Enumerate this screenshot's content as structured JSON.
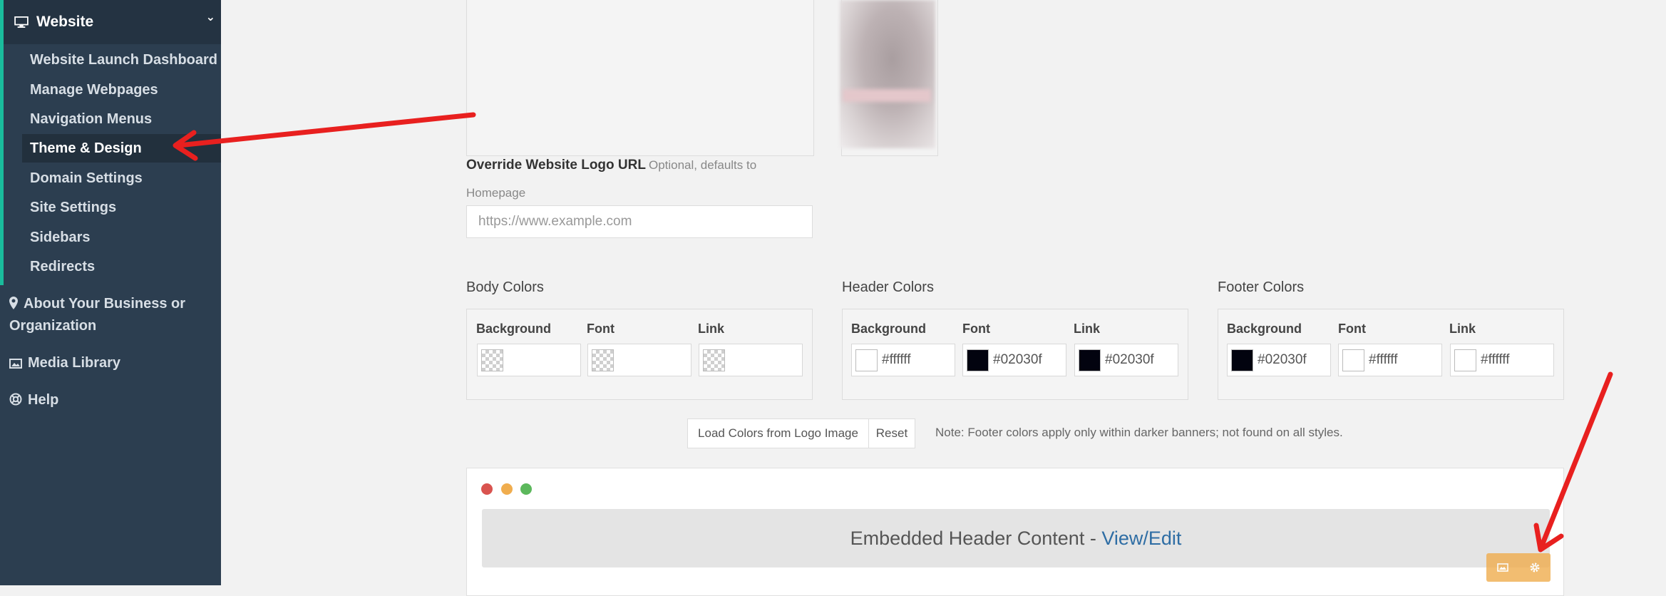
{
  "sidebar": {
    "header_label": "Website",
    "sub_items": [
      {
        "label": "Website Launch Dashboard"
      },
      {
        "label": "Manage Webpages"
      },
      {
        "label": "Navigation Menus"
      },
      {
        "label": "Theme & Design",
        "active": true
      },
      {
        "label": "Domain Settings"
      },
      {
        "label": "Site Settings"
      },
      {
        "label": "Sidebars"
      },
      {
        "label": "Redirects"
      }
    ],
    "about_line1": "About Your Business or",
    "about_line2": "Organization",
    "media_label": "Media Library",
    "help_label": "Help"
  },
  "logo": {
    "override_label": "Override Website Logo URL",
    "override_hint_1": "Optional, defaults to",
    "override_hint_2": "Homepage",
    "url_placeholder": "https://www.example.com",
    "url_value": ""
  },
  "colors": {
    "body": {
      "title": "Body Colors",
      "labels": [
        "Background",
        "Font",
        "Link"
      ],
      "values": [
        "",
        "",
        ""
      ]
    },
    "header": {
      "title": "Header Colors",
      "labels": [
        "Background",
        "Font",
        "Link"
      ],
      "values": [
        "#ffffff",
        "#02030f",
        "#02030f"
      ]
    },
    "footer": {
      "title": "Footer Colors",
      "labels": [
        "Background",
        "Font",
        "Link"
      ],
      "values": [
        "#02030f",
        "#ffffff",
        "#ffffff"
      ]
    }
  },
  "actions": {
    "load_colors_label": "Load Colors from Logo Image",
    "reset_label": "Reset",
    "note": "Note: Footer colors apply only within darker banners; not found on all styles."
  },
  "preview": {
    "embedded_text": "Embedded Header Content - ",
    "embedded_link": "View/Edit",
    "window_dots": [
      "#d9534f",
      "#f0ad4e",
      "#5cb85c"
    ]
  },
  "theme": {
    "sidebar_bg": "#2c3e50",
    "sidebar_accent": "#1abc9c",
    "annotation_arrow": "#e8201f",
    "edit_buttons": "#f0ad4e",
    "link": "#2e6da4"
  }
}
